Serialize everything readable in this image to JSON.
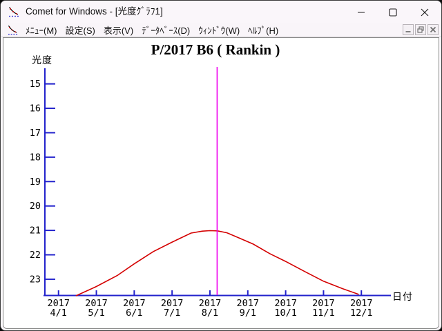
{
  "window": {
    "title": "Comet for Windows - [光度ｸﾞﾗﾌ1]",
    "icons": {
      "app": "light-curve-chart-icon",
      "minimize": "minimize-icon",
      "maximize": "maximize-icon",
      "close": "close-icon"
    }
  },
  "menu": {
    "items": [
      {
        "label": "ﾒﾆｭｰ(M)"
      },
      {
        "label": "設定(S)"
      },
      {
        "label": "表示(V)"
      },
      {
        "label": "ﾃﾞｰﾀﾍﾞｰｽ(D)"
      },
      {
        "label": "ｳｨﾝﾄﾞｳ(W)"
      },
      {
        "label": "ﾍﾙﾌﾟ(H)"
      }
    ],
    "mdi_controls": [
      {
        "icon": "mdi-minimize-icon"
      },
      {
        "icon": "mdi-restore-icon"
      },
      {
        "icon": "mdi-close-icon"
      }
    ]
  },
  "chart_data": {
    "type": "line",
    "title": "P/2017 B6 ( Rankin )",
    "xlabel": "日付",
    "ylabel": "光度",
    "x_unit": "months since 2017-04-01",
    "x_ticks": [
      {
        "line1": "2017",
        "line2": "4/1"
      },
      {
        "line1": "2017",
        "line2": "5/1"
      },
      {
        "line1": "2017",
        "line2": "6/1"
      },
      {
        "line1": "2017",
        "line2": "7/1"
      },
      {
        "line1": "2017",
        "line2": "8/1"
      },
      {
        "line1": "2017",
        "line2": "9/1"
      },
      {
        "line1": "2017",
        "line2": "10/1"
      },
      {
        "line1": "2017",
        "line2": "11/1"
      },
      {
        "line1": "2017",
        "line2": "12/1"
      }
    ],
    "y_ticks": [
      15,
      16,
      17,
      18,
      19,
      20,
      21,
      22,
      23
    ],
    "y_axis_inverted": true,
    "xlim": [
      -0.36,
      8.78
    ],
    "ylim": [
      14.36,
      23.68
    ],
    "grid": false,
    "axis_color": "#2222cc",
    "series": [
      {
        "name": "predicted-magnitude-curve",
        "color": "#d40000",
        "points": [
          [
            0.46,
            23.68
          ],
          [
            1.0,
            23.3
          ],
          [
            1.55,
            22.85
          ],
          [
            2.0,
            22.37
          ],
          [
            2.5,
            21.87
          ],
          [
            3.0,
            21.48
          ],
          [
            3.5,
            21.11
          ],
          [
            3.8,
            21.03
          ],
          [
            4.0,
            21.01
          ],
          [
            4.2,
            21.02
          ],
          [
            4.45,
            21.1
          ],
          [
            4.68,
            21.25
          ],
          [
            5.14,
            21.56
          ],
          [
            5.59,
            21.96
          ],
          [
            6.0,
            22.27
          ],
          [
            6.51,
            22.69
          ],
          [
            7.0,
            23.08
          ],
          [
            7.51,
            23.39
          ],
          [
            7.93,
            23.62
          ]
        ]
      }
    ],
    "marker_line": {
      "x": 4.19,
      "color": "#ee00ee"
    }
  }
}
